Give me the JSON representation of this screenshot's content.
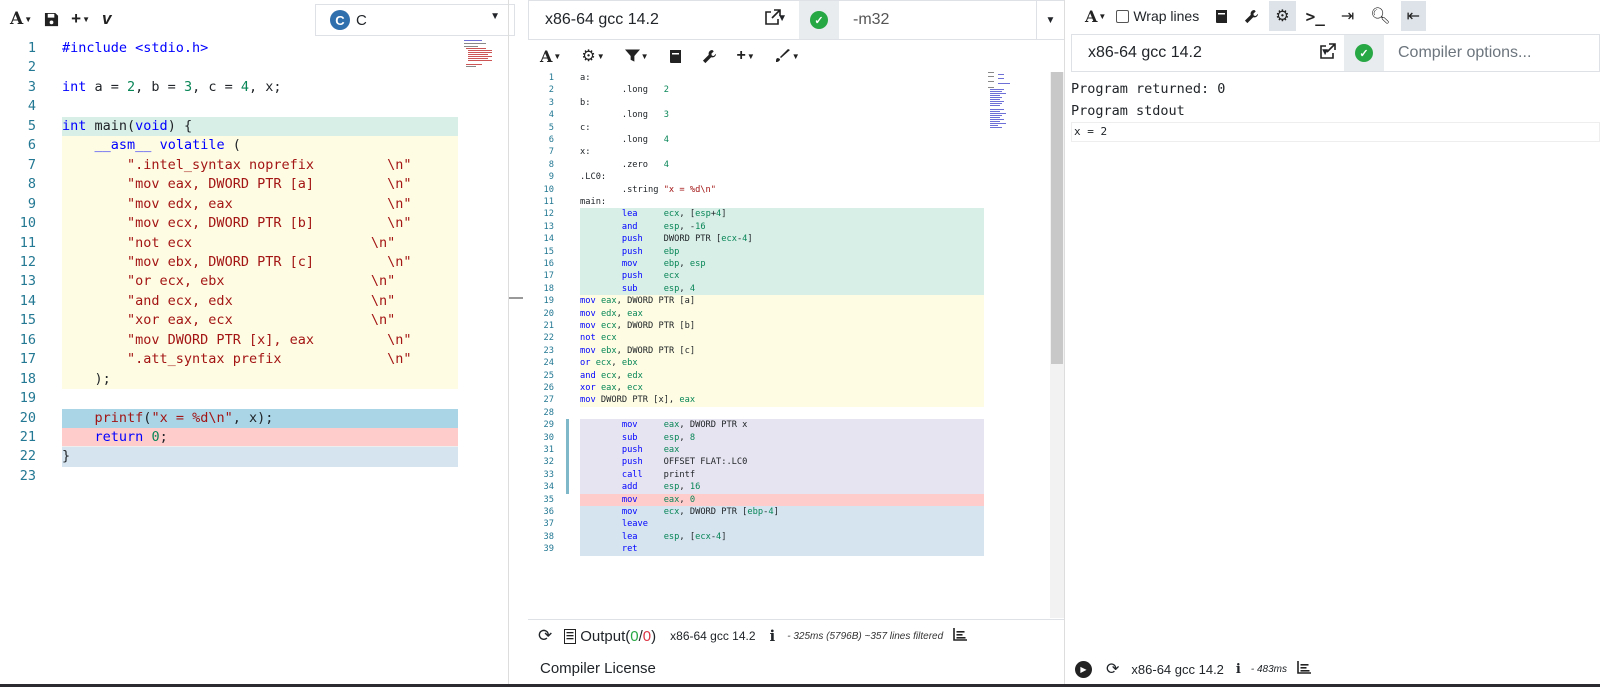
{
  "colors": {
    "accent_ok": "#28a745",
    "highlight_green": "#d8efe7",
    "highlight_yellow": "#fefde3",
    "highlight_blue": "#a9d5e6",
    "highlight_red": "#ffcccc",
    "highlight_lightblue": "#d5e4ef"
  },
  "source": {
    "toolbar": {
      "font_icon": "font-size-icon",
      "save_icon": "save-icon",
      "add_icon": "plus-icon",
      "vim_icon": "vim-icon",
      "language": "C"
    },
    "lines": [
      {
        "n": "1",
        "code": "#include <stdio.h>"
      },
      {
        "n": "2",
        "code": ""
      },
      {
        "n": "3",
        "code": "int a = 2, b = 3, c = 4, x;"
      },
      {
        "n": "4",
        "code": ""
      },
      {
        "n": "5",
        "code": "int main(void) {"
      },
      {
        "n": "6",
        "code": "    __asm__ volatile ("
      },
      {
        "n": "7",
        "code": "        \".intel_syntax noprefix         \\n\""
      },
      {
        "n": "8",
        "code": "        \"mov eax, DWORD PTR [a]         \\n\""
      },
      {
        "n": "9",
        "code": "        \"mov edx, eax                   \\n\""
      },
      {
        "n": "10",
        "code": "        \"mov ecx, DWORD PTR [b]         \\n\""
      },
      {
        "n": "11",
        "code": "        \"not ecx                      \\n\""
      },
      {
        "n": "12",
        "code": "        \"mov ebx, DWORD PTR [c]         \\n\""
      },
      {
        "n": "13",
        "code": "        \"or ecx, ebx                  \\n\""
      },
      {
        "n": "14",
        "code": "        \"and ecx, edx                 \\n\""
      },
      {
        "n": "15",
        "code": "        \"xor eax, ecx                 \\n\""
      },
      {
        "n": "16",
        "code": "        \"mov DWORD PTR [x], eax         \\n\""
      },
      {
        "n": "17",
        "code": "        \".att_syntax prefix             \\n\""
      },
      {
        "n": "18",
        "code": "    );"
      },
      {
        "n": "19",
        "code": ""
      },
      {
        "n": "20",
        "code": "    printf(\"x = %d\\n\", x);"
      },
      {
        "n": "21",
        "code": "    return 0;"
      },
      {
        "n": "22",
        "code": "}"
      },
      {
        "n": "23",
        "code": ""
      }
    ]
  },
  "compiler": {
    "name": "x86-64 gcc 14.2",
    "options": "-m32",
    "toolbar": [
      "font-size-icon",
      "gear-icon",
      "filter-icon",
      "book-icon",
      "wrench-icon",
      "plus-icon",
      "brush-icon"
    ],
    "asm": [
      {
        "n": "1",
        "code": "a:"
      },
      {
        "n": "2",
        "code": "        .long   2"
      },
      {
        "n": "3",
        "code": "b:"
      },
      {
        "n": "4",
        "code": "        .long   3"
      },
      {
        "n": "5",
        "code": "c:"
      },
      {
        "n": "6",
        "code": "        .long   4"
      },
      {
        "n": "7",
        "code": "x:"
      },
      {
        "n": "8",
        "code": "        .zero   4"
      },
      {
        "n": "9",
        "code": ".LC0:"
      },
      {
        "n": "10",
        "code": "        .string \"x = %d\\n\""
      },
      {
        "n": "11",
        "code": "main:"
      },
      {
        "n": "12",
        "code": "        lea     ecx, [esp+4]"
      },
      {
        "n": "13",
        "code": "        and     esp, -16"
      },
      {
        "n": "14",
        "code": "        push    DWORD PTR [ecx-4]"
      },
      {
        "n": "15",
        "code": "        push    ebp"
      },
      {
        "n": "16",
        "code": "        mov     ebp, esp"
      },
      {
        "n": "17",
        "code": "        push    ecx"
      },
      {
        "n": "18",
        "code": "        sub     esp, 4"
      },
      {
        "n": "19",
        "code": "mov eax, DWORD PTR [a]"
      },
      {
        "n": "20",
        "code": "mov edx, eax"
      },
      {
        "n": "21",
        "code": "mov ecx, DWORD PTR [b]"
      },
      {
        "n": "22",
        "code": "not ecx"
      },
      {
        "n": "23",
        "code": "mov ebx, DWORD PTR [c]"
      },
      {
        "n": "24",
        "code": "or ecx, ebx"
      },
      {
        "n": "25",
        "code": "and ecx, edx"
      },
      {
        "n": "26",
        "code": "xor eax, ecx"
      },
      {
        "n": "27",
        "code": "mov DWORD PTR [x], eax"
      },
      {
        "n": "28",
        "code": ""
      },
      {
        "n": "29",
        "code": "        mov     eax, DWORD PTR x"
      },
      {
        "n": "30",
        "code": "        sub     esp, 8"
      },
      {
        "n": "31",
        "code": "        push    eax"
      },
      {
        "n": "32",
        "code": "        push    OFFSET FLAT:.LC0"
      },
      {
        "n": "33",
        "code": "        call    printf"
      },
      {
        "n": "34",
        "code": "        add     esp, 16"
      },
      {
        "n": "35",
        "code": "        mov     eax, 0"
      },
      {
        "n": "36",
        "code": "        mov     ecx, DWORD PTR [ebp-4]"
      },
      {
        "n": "37",
        "code": "        leave"
      },
      {
        "n": "38",
        "code": "        lea     esp, [ecx-4]"
      },
      {
        "n": "39",
        "code": "        ret"
      }
    ],
    "status": {
      "output_label": "Output",
      "output_open": " (",
      "output_ok": "0",
      "output_slash": "/",
      "output_err": "0",
      "output_close": ")",
      "compiler_name": "x86-64 gcc 14.2",
      "info": "i",
      "timing": "- 325ms (5796B) ~357 lines filtered"
    },
    "license": "Compiler License"
  },
  "executor": {
    "wrap_lines": "Wrap lines",
    "name": "x86-64 gcc 14.2",
    "options_placeholder": "Compiler options...",
    "output": {
      "returned": "Program returned: 0",
      "stdout_label": "Program stdout",
      "stdout": "x = 2"
    },
    "status": {
      "compiler_name": "x86-64 gcc 14.2",
      "info": "i",
      "timing": "- 483ms"
    }
  }
}
